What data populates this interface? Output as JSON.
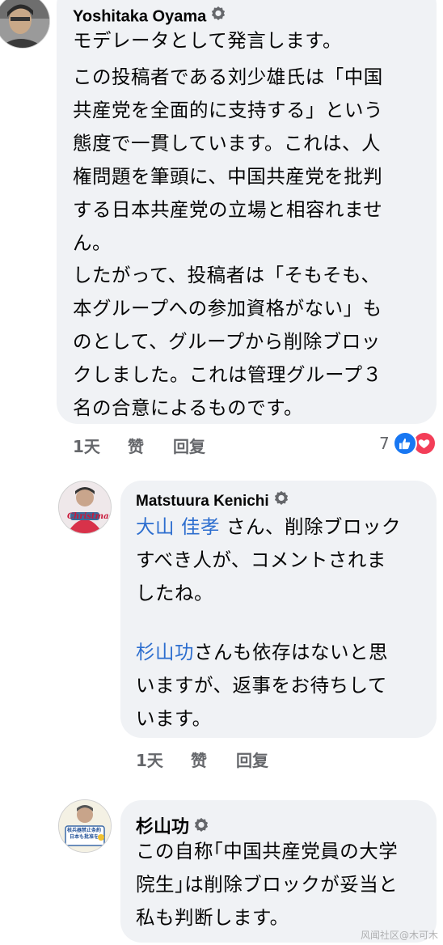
{
  "comments": [
    {
      "author": "Yoshitaka Oyama",
      "lines": [
        "モデレータとして発言します。",
        "この投稿者である刘少雄氏は「中国",
        "共産党を全面的に支持する」という",
        "態度で一貫しています。これは、人",
        "権問題を筆頭に、中国共産党を批判",
        "する日本共産党の立場と相容れませ",
        "ん。",
        "したがって、投稿者は「そもそも、",
        "本グループへの参加資格がない」も",
        "のとして、グループから削除ブロッ",
        "クしました。これは管理グループ３",
        "名の合意によるものです。"
      ],
      "time": "1天",
      "like": "赞",
      "reply": "回复",
      "reaction_count": "7"
    },
    {
      "author": "Matstuura Kenichi",
      "mention1": "大山 佳孝",
      "line1_rest": " さん、削除ブロック",
      "line2": "すべき人が、コメントされま",
      "line3": "したね。",
      "mention2": "杉山功",
      "line5_rest": "さんも依存はないと思",
      "line6": "いますが、返事をお待ちして",
      "line7": "います。",
      "time": "1天",
      "like": "赞",
      "reply": "回复",
      "avatar_text": "Christmas"
    },
    {
      "author": "杉山功",
      "lines": [
        "この自称｢中国共産党員の大学",
        "院生｣は削除ブロックが妥当と",
        "私も判断します。"
      ],
      "avatar_text": "核兵器禁止条約 日本も批准を"
    }
  ],
  "watermark": "风闻社区@木可木",
  "colors": {
    "bubble": "#f0f2f5",
    "mention": "#2d6ecf",
    "like_blue": "#1877f2",
    "love_red": "#f33e58"
  }
}
